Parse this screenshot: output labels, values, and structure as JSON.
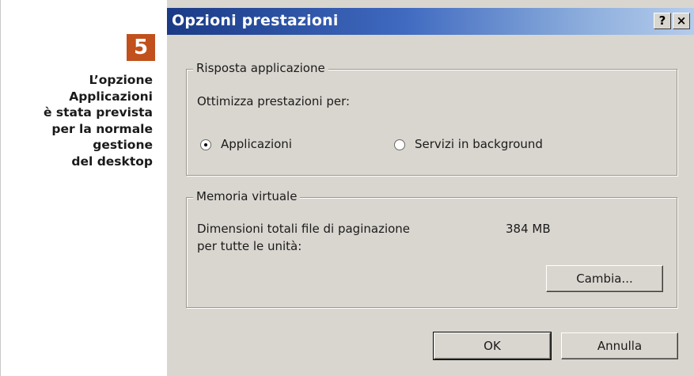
{
  "caption": {
    "step": "5",
    "text": "L’opzione\nApplicazioni\nè stata prevista\nper la normale\ngestione\ndel desktop"
  },
  "dialog": {
    "title": "Opzioni prestazioni",
    "help_button": "?",
    "close_button": "×",
    "app_response": {
      "legend": "Risposta applicazione",
      "optimize_label": "Ottimizza prestazioni per:",
      "options": [
        {
          "label": "Applicazioni",
          "selected": true
        },
        {
          "label": "Servizi in background",
          "selected": false
        }
      ]
    },
    "virtual_memory": {
      "legend": "Memoria virtuale",
      "size_label_line1": "Dimensioni totali file di paginazione",
      "size_label_line2": "per tutte le unità:",
      "size_value": "384 MB",
      "change_button": "Cambia..."
    },
    "ok_button": "OK",
    "cancel_button": "Annulla"
  },
  "colors": {
    "badge": "#c2501c",
    "titlebar_start": "#1a3a86",
    "titlebar_end": "#b5ccec",
    "dialog_bg": "#d9d6cf"
  }
}
